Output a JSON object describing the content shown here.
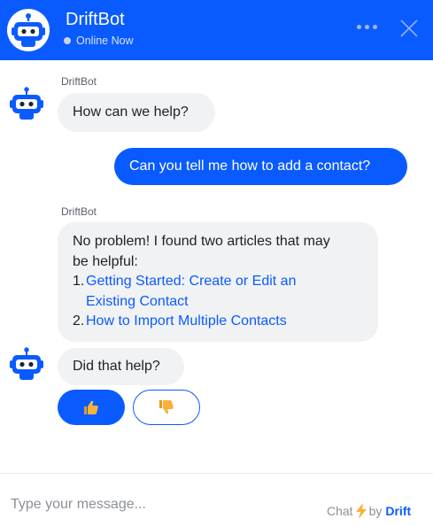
{
  "header": {
    "title": "DriftBot",
    "status": "Online Now"
  },
  "messages": {
    "bot_1_sender": "DriftBot",
    "bot_1_text": "How can we help?",
    "user_1_text": "Can you tell me how to add a contact?",
    "bot_2_sender": "DriftBot",
    "bot_2_intro_line1": "No problem! I found two articles that may",
    "bot_2_intro_line2": "be helpful:",
    "article_1_num": "1.",
    "article_1_line1": "Getting Started: Create or Edit an",
    "article_1_line2": "Existing Contact",
    "article_2_num": "2.",
    "article_2_text": "How to Import Multiple Contacts",
    "bot_3_text": "Did that help?"
  },
  "feedback": {
    "up_icon": "thumbs-up-icon",
    "down_icon": "thumbs-down-icon"
  },
  "composer": {
    "placeholder": "Type your message..."
  },
  "branding": {
    "prefix": "Chat",
    "by": "by",
    "brand": "Drift"
  },
  "colors": {
    "accent": "#0a5bff",
    "bot_bubble": "#f1f2f4",
    "thumb_yellow": "#f7b23b"
  }
}
